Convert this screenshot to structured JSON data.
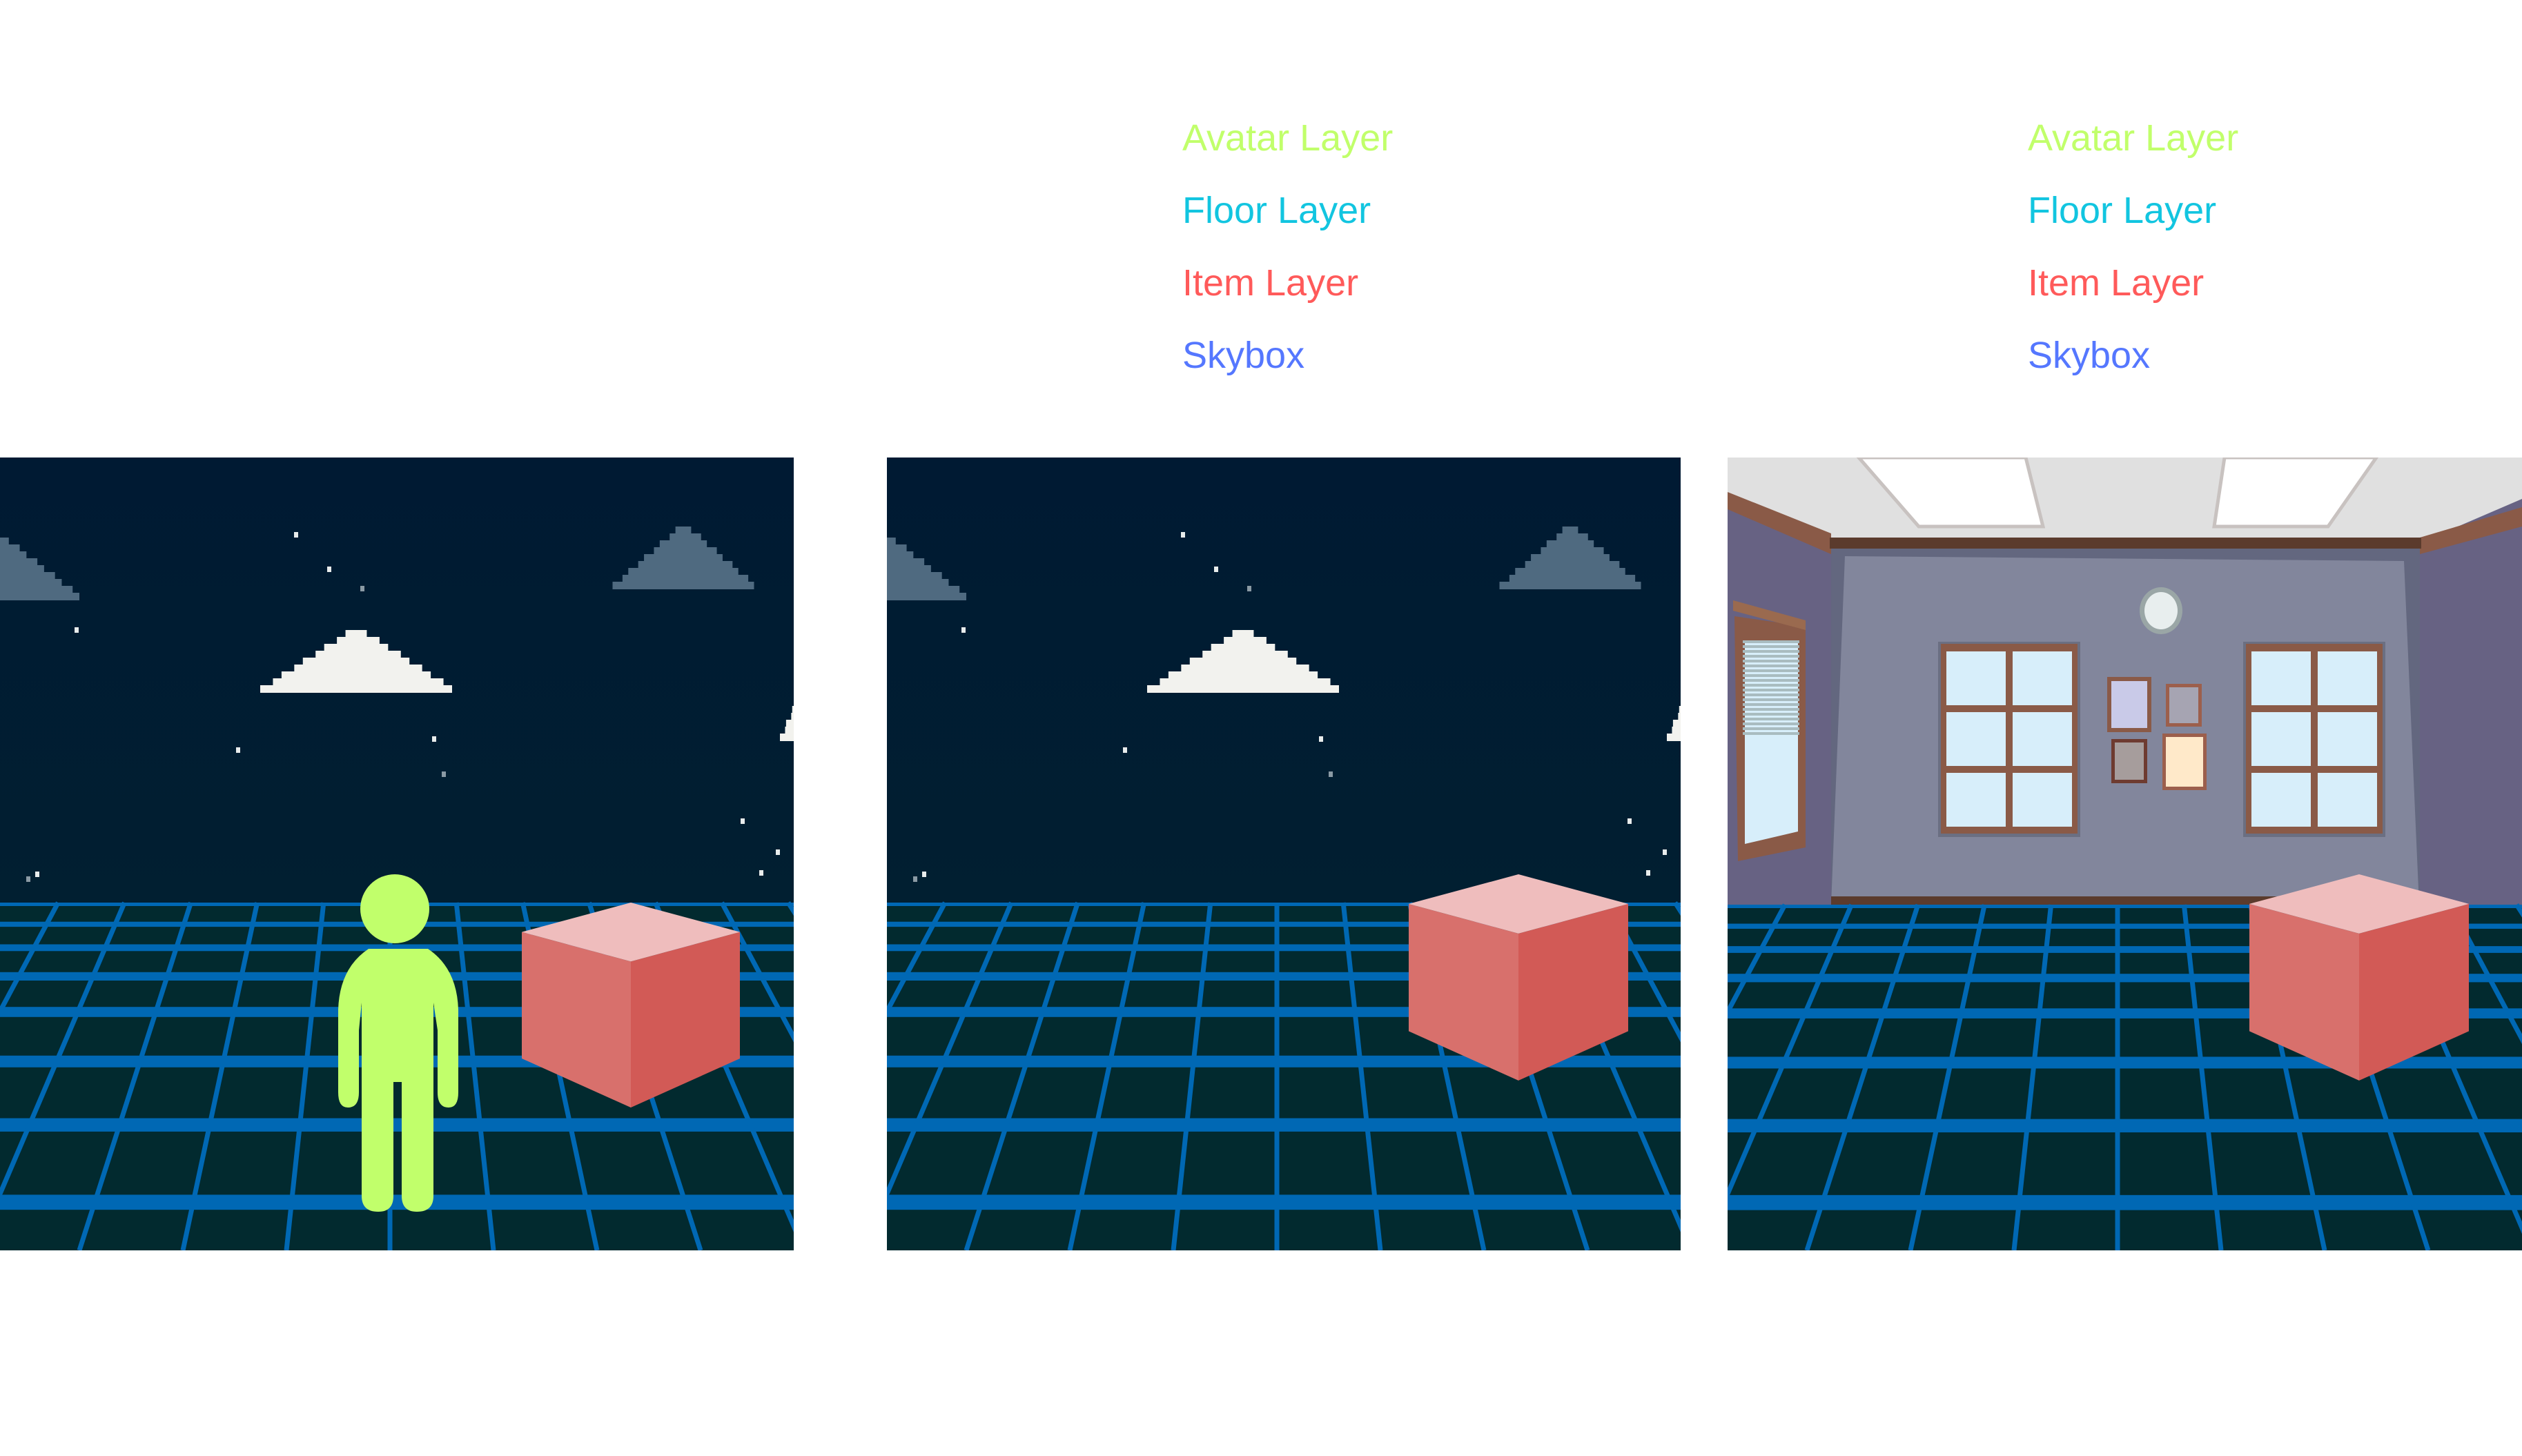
{
  "colors": {
    "avatar": "#c1ff6b",
    "floor": "#12c5e0",
    "item": "#ff5a5a",
    "skybox": "#5577ff",
    "sky_top": "#001a33",
    "sky_bottom": "#02232f",
    "grid_line": "#0068b4",
    "floor_fill": "#022a2f",
    "cube_top": "#efbdbd",
    "cube_left": "#d8706c",
    "cube_right": "#d25a56",
    "cloud_light": "#f2f2ee",
    "cloud_dark": "#4f6a80",
    "wall_back": "#82869c",
    "wall_side": "#676283",
    "ceiling": "#e0e0e0",
    "trim": "#5b3b2d",
    "window_frame": "#8a5a47",
    "glass": "#d7eefa"
  },
  "legends": [
    {
      "items": [
        {
          "label": "Avatar Layer",
          "color": "#c1ff6b"
        },
        {
          "label": "Floor Layer",
          "color": "#12c5e0"
        },
        {
          "label": "Item Layer",
          "color": "#ff5a5a"
        },
        {
          "label": "Skybox",
          "color": "#5577ff"
        }
      ]
    },
    {
      "items": [
        {
          "label": "Avatar Layer",
          "color": "#c1ff6b"
        },
        {
          "label": "Floor Layer",
          "color": "#12c5e0"
        },
        {
          "label": "Item Layer",
          "color": "#ff5a5a"
        },
        {
          "label": "Skybox",
          "color": "#5577ff"
        }
      ]
    }
  ],
  "panels": [
    {
      "name": "composited-scene",
      "skybox": "night-sky",
      "has_avatar": true,
      "has_item": true,
      "has_floor": true
    },
    {
      "name": "layers-night-sky",
      "skybox": "night-sky",
      "has_avatar": false,
      "has_item": true,
      "has_floor": true
    },
    {
      "name": "layers-room",
      "skybox": "room",
      "has_avatar": false,
      "has_item": true,
      "has_floor": true
    }
  ]
}
